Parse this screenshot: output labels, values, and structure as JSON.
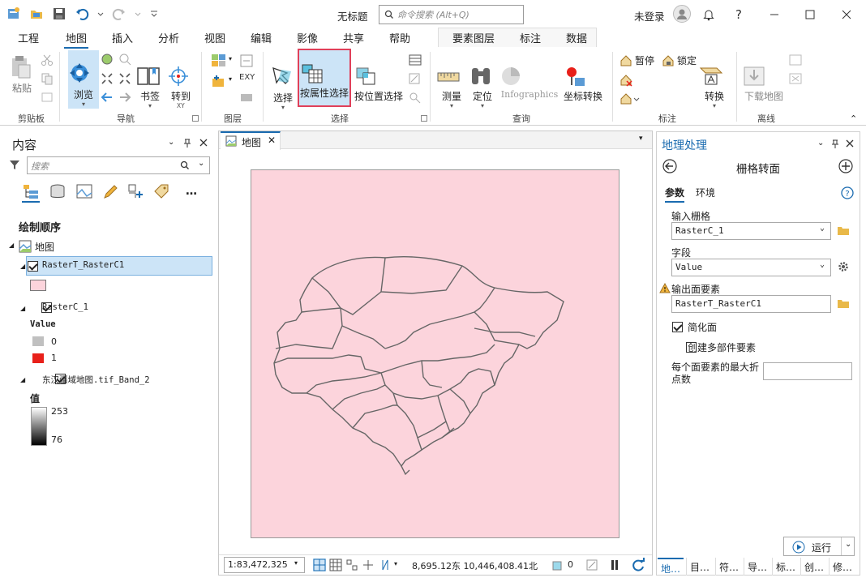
{
  "title_bar": {
    "document_title": "无标题",
    "search_placeholder": "命令搜索 (Alt+Q)",
    "user_label": "未登录",
    "help": "?"
  },
  "menu_tabs": [
    "工程",
    "地图",
    "插入",
    "分析",
    "视图",
    "编辑",
    "影像",
    "共享",
    "帮助"
  ],
  "active_tab": "地图",
  "context_tabs": [
    "要素图层",
    "标注",
    "数据"
  ],
  "ribbon": {
    "clipboard": {
      "group": "剪贴板",
      "paste": "粘贴"
    },
    "navigate": {
      "group": "导航",
      "explore": "浏览",
      "bookmarks": "书签",
      "goto": "转到",
      "goto_sub": "XY"
    },
    "layer": {
      "group": "图层",
      "xy_label": "EXY"
    },
    "selection": {
      "group": "选择",
      "select": "选择",
      "select_by_attributes": "按属性选择",
      "select_by_location": "按位置选择"
    },
    "inquiry": {
      "group": "查询",
      "measure": "测量",
      "locate": "定位",
      "infographics": "Infographics",
      "coordinate_conversion": "坐标转换"
    },
    "labeling": {
      "group": "标注",
      "pause": "暂停",
      "lock": "锁定",
      "convert": "转换"
    },
    "offline": {
      "group": "离线",
      "download_map": "下载地图"
    }
  },
  "contents": {
    "title": "内容",
    "search_placeholder": "搜索",
    "drawing_order": "绘制顺序",
    "map_name": "地图",
    "layers": [
      {
        "name": "RasterT_RasterC1",
        "checked": true,
        "selected": true,
        "swatch": "#fcd4dc"
      },
      {
        "name": "RasterC_1",
        "checked": true,
        "legend_title": "Value",
        "classes": [
          {
            "label": "0",
            "color": "#c0c0c0"
          },
          {
            "label": "1",
            "color": "#e8201a"
          }
        ]
      },
      {
        "name": "东汉疆域地图.tif_Band_2",
        "checked": true,
        "legend_title": "值",
        "high": "253",
        "low": "76"
      }
    ]
  },
  "map_view": {
    "tab_label": "地图",
    "scale": "1:83,472,325",
    "coords": "8,695.12东 10,446,408.41北",
    "selected_count": "0",
    "raster_fill": "#fcd4dc"
  },
  "geoprocessing": {
    "panel_title": "地理处理",
    "tool_title": "栅格转面",
    "tabs": [
      "参数",
      "环境"
    ],
    "input_raster_label": "输入栅格",
    "input_raster_value": "RasterC_1",
    "field_label": "字段",
    "field_value": "Value",
    "output_label": "输出面要素",
    "output_value": "RasterT_RasterC1",
    "simplify_label": "简化面",
    "simplify_checked": true,
    "multipart_label": "创建多部件要素",
    "multipart_checked": false,
    "max_vertices_label_1": "每个面要素的最大折",
    "max_vertices_label_2": "点数",
    "run_label": "运行",
    "bottom_tabs": [
      "地…",
      "目…",
      "符…",
      "导…",
      "标…",
      "创…",
      "修…"
    ]
  },
  "colors": {
    "accent": "#1a6bb0",
    "highlight_box": "#e0405a",
    "selection_bg": "#cce4f7"
  }
}
